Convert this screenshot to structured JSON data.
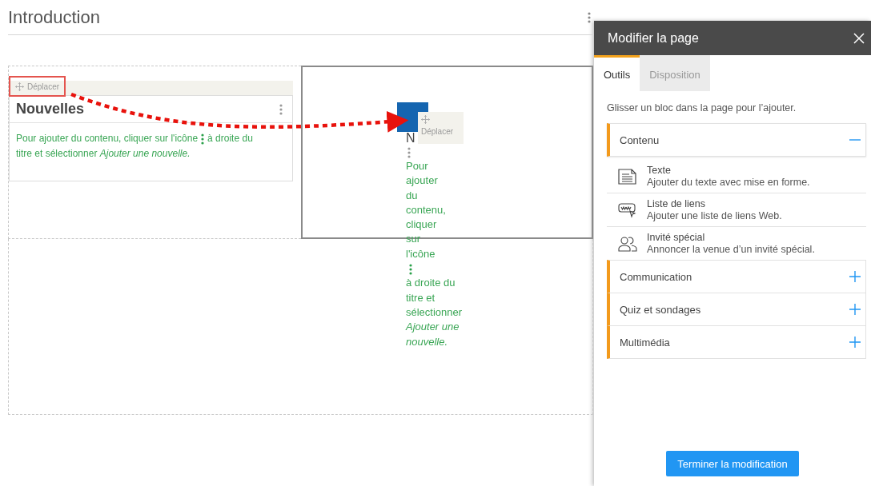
{
  "page": {
    "title": "Introduction"
  },
  "news_block": {
    "handle": "Déplacer",
    "highlighted": true,
    "title": "Nouvelles",
    "hint_before": "Pour ajouter du contenu, cliquer sur l'icône",
    "hint_after": "à droite du",
    "hint_end": "titre et sélectionner  *Ajouter une nouvelle.*"
  },
  "drag_ghost": {
    "handle": "Déplacer",
    "title": "N",
    "hint_before": "Pour ajouter du contenu, cliquer sur l'icône",
    "hint_after": "à droite du titre et sélectionner *Ajouter une nouvelle.*"
  },
  "panel": {
    "title": "Modifier la page",
    "tabs": [
      {
        "label": "Outils",
        "selected": true
      },
      {
        "label": "Disposition",
        "selected": false
      }
    ],
    "instruction": "Glisser un bloc dans la page pour l’ajouter.",
    "sections": [
      {
        "label": "Contenu",
        "expanded": true,
        "items": [
          {
            "kind": "text",
            "title": "Texte",
            "description": "Ajouter du texte avec mise en forme."
          },
          {
            "kind": "links",
            "title": "Liste de liens",
            "description": "Ajouter une liste de liens Web."
          },
          {
            "kind": "guest",
            "title": "Invité spécial",
            "description": "Annoncer la venue d’un invité spécial."
          }
        ]
      },
      {
        "label": "Communication",
        "expanded": false
      },
      {
        "label": "Quiz et sondages",
        "expanded": false
      },
      {
        "label": "Multimédia",
        "expanded": false
      }
    ],
    "finish_button": "Terminer la modification"
  }
}
